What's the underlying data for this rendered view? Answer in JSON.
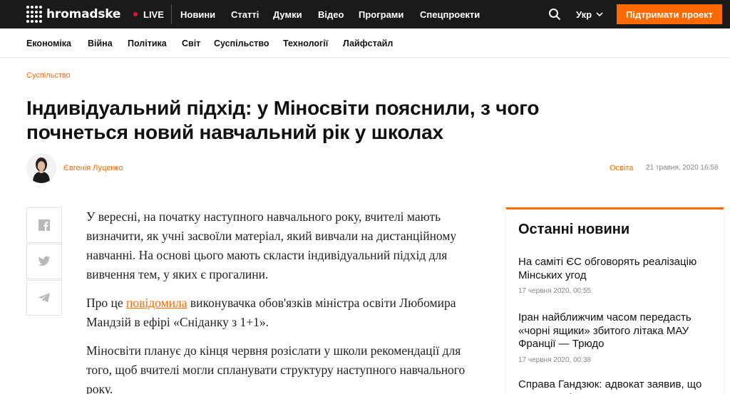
{
  "header": {
    "logo_text": "hromadske",
    "live_label": "LIVE",
    "nav": [
      "Новини",
      "Статті",
      "Думки",
      "Відео",
      "Програми",
      "Спецпроекти"
    ],
    "lang": "Укр",
    "support_label": "Підтримати проект",
    "colors": {
      "bar": "#1a1a1a",
      "accent": "#ff6a00",
      "live": "#e8112d"
    }
  },
  "subnav": [
    "Економіка",
    "Війна",
    "Політика",
    "Світ",
    "Суспільство",
    "Технології",
    "Лайфстайл"
  ],
  "article": {
    "category": "Суспільство",
    "headline": "Індивідуальний підхід: у Міносвіти пояснили, з чого почнеться новий навчальний рік у школах",
    "author": "Євгенія Луценко",
    "tag": "Освіта",
    "date": "21 травня, 2020 16:58",
    "p1": "У вересні, на початку наступного навчального року, вчителі мають визначити, як учні засвоїли матеріал, який вивчали на дистанційному навчанні. На основі цього мають скласти індивідуальний підхід для вивчення тем, у яких є прогалини.",
    "p2_before": "Про це ",
    "p2_link": "повідомила",
    "p2_after": " виконувачка обов'язків міністра освіти Любомира Мандзій в ефірі «Сніданку з 1+1».",
    "p3": "Міносвіти планує до кінця червня розіслати у школи рекомендації для того, щоб вчителі могли спланувати структуру наступного навчального року."
  },
  "share": [
    "facebook-icon",
    "twitter-icon",
    "telegram-icon"
  ],
  "sidebar": {
    "title": "Останні новини",
    "items": [
      {
        "title": "На саміті ЄС обговорять реалізацію Мінських угод",
        "time": "17 червня 2020, 00:55"
      },
      {
        "title": "Іран найближчим часом передасть «чорні ящики» збитого літака МАУ Франції — Трюдо",
        "time": "17 червня 2020, 00:38"
      },
      {
        "title": "Справа Гандзюк: адвокат заявив, що Мангера після суду затримали",
        "time": ""
      }
    ]
  }
}
